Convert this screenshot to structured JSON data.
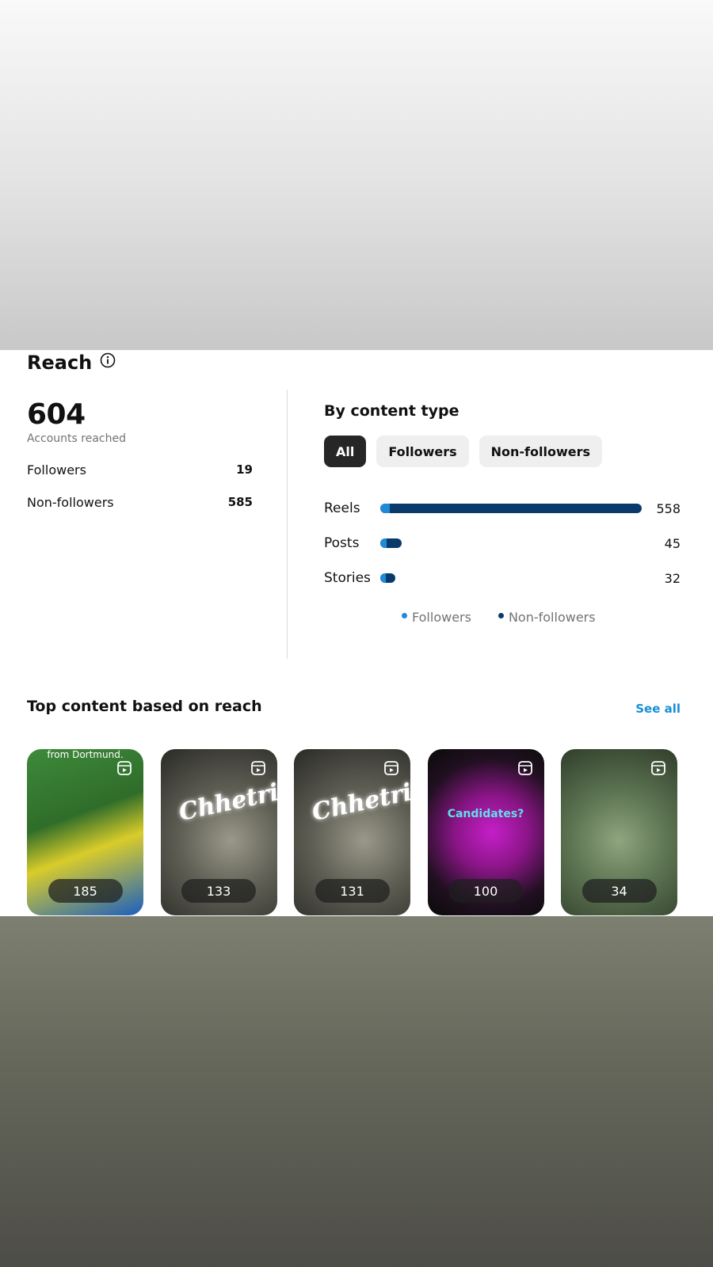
{
  "reach": {
    "title": "Reach",
    "accounts_reached": "604",
    "accounts_reached_label": "Accounts reached",
    "followers_label": "Followers",
    "followers_value": "19",
    "nonfollowers_label": "Non-followers",
    "nonfollowers_value": "585"
  },
  "content_type": {
    "title": "By content type",
    "filters": [
      "All",
      "Followers",
      "Non-followers"
    ],
    "active_filter": "All",
    "rows": [
      {
        "label": "Reels",
        "value": "558",
        "total": 558,
        "followers_fraction": 0.035
      },
      {
        "label": "Posts",
        "value": "45",
        "total": 45,
        "followers_fraction": 0.3
      },
      {
        "label": "Stories",
        "value": "32",
        "total": 32,
        "followers_fraction": 0.3
      }
    ],
    "legend": {
      "followers": "Followers",
      "nonfollowers": "Non-followers"
    },
    "colors": {
      "followers": "#1f8ad6",
      "nonfollowers": "#0a3a6b"
    }
  },
  "top_content": {
    "title": "Top content based on reach",
    "see_all": "See all",
    "items": [
      {
        "count": "185",
        "caption": "from Dortmund."
      },
      {
        "count": "133",
        "caption": "Chhetri"
      },
      {
        "count": "131",
        "caption": "Chhetri"
      },
      {
        "count": "100",
        "caption": "Candidates?"
      },
      {
        "count": "34",
        "caption": ""
      }
    ]
  }
}
